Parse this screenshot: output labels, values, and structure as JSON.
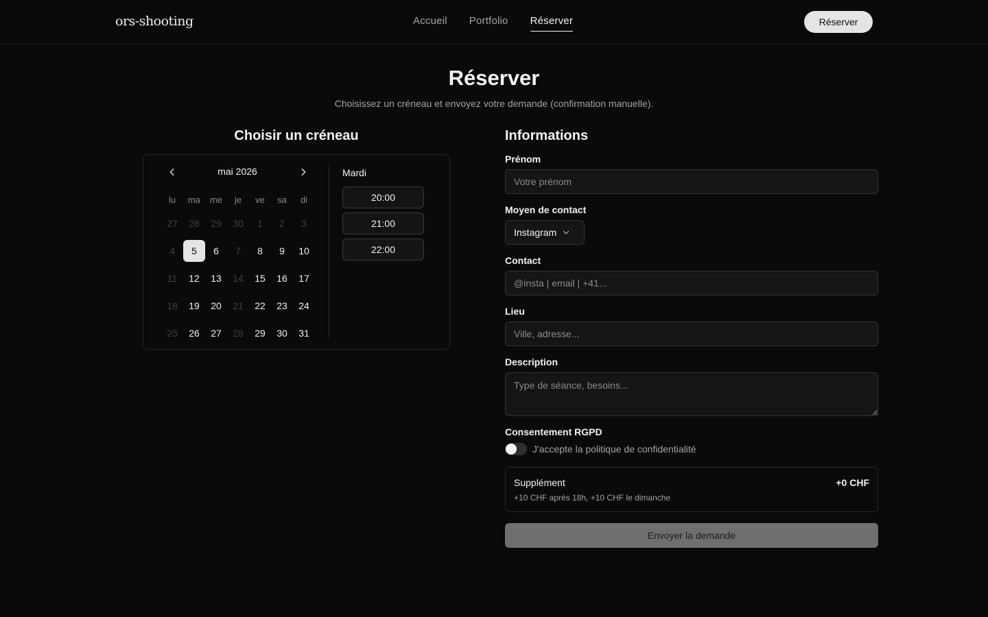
{
  "header": {
    "brand": "ors-shooting",
    "nav": [
      "Accueil",
      "Portfolio",
      "Réserver"
    ],
    "cta": "Réserver"
  },
  "page": {
    "title": "Réserver",
    "subtitle": "Choisissez un créneau et envoyez votre demande (confirmation manuelle)."
  },
  "calendar": {
    "heading": "Choisir un créneau",
    "month": "mai 2026",
    "weekdays": [
      "lu",
      "ma",
      "me",
      "je",
      "ve",
      "sa",
      "di"
    ],
    "days": [
      {
        "d": "27",
        "s": "outside"
      },
      {
        "d": "28",
        "s": "outside"
      },
      {
        "d": "29",
        "s": "outside"
      },
      {
        "d": "30",
        "s": "outside"
      },
      {
        "d": "1",
        "s": "outside"
      },
      {
        "d": "2",
        "s": "outside"
      },
      {
        "d": "3",
        "s": "outside"
      },
      {
        "d": "4",
        "s": "disabled"
      },
      {
        "d": "5",
        "s": "selected"
      },
      {
        "d": "6",
        "s": ""
      },
      {
        "d": "7",
        "s": "disabled"
      },
      {
        "d": "8",
        "s": ""
      },
      {
        "d": "9",
        "s": ""
      },
      {
        "d": "10",
        "s": ""
      },
      {
        "d": "11",
        "s": "disabled"
      },
      {
        "d": "12",
        "s": ""
      },
      {
        "d": "13",
        "s": ""
      },
      {
        "d": "14",
        "s": "disabled"
      },
      {
        "d": "15",
        "s": ""
      },
      {
        "d": "16",
        "s": ""
      },
      {
        "d": "17",
        "s": ""
      },
      {
        "d": "18",
        "s": "disabled"
      },
      {
        "d": "19",
        "s": ""
      },
      {
        "d": "20",
        "s": ""
      },
      {
        "d": "21",
        "s": "disabled"
      },
      {
        "d": "22",
        "s": ""
      },
      {
        "d": "23",
        "s": ""
      },
      {
        "d": "24",
        "s": ""
      },
      {
        "d": "25",
        "s": "disabled"
      },
      {
        "d": "26",
        "s": ""
      },
      {
        "d": "27",
        "s": ""
      },
      {
        "d": "28",
        "s": "disabled"
      },
      {
        "d": "29",
        "s": ""
      },
      {
        "d": "30",
        "s": ""
      },
      {
        "d": "31",
        "s": ""
      }
    ],
    "selected_day_name": "Mardi",
    "time_slots": [
      "20:00",
      "21:00",
      "22:00"
    ]
  },
  "form": {
    "heading": "Informations",
    "first_name": {
      "label": "Prénom",
      "placeholder": "Votre prénom"
    },
    "contact_method": {
      "label": "Moyen de contact",
      "value": "Instagram"
    },
    "contact": {
      "label": "Contact",
      "placeholder": "@insta | email | +41..."
    },
    "location": {
      "label": "Lieu",
      "placeholder": "Ville, adresse..."
    },
    "description": {
      "label": "Description",
      "placeholder": "Type de séance, besoins..."
    },
    "consent": {
      "label": "Consentement RGPD",
      "text": "J'accepte la politique de confidentialité",
      "checked": false
    },
    "supplement": {
      "title": "Supplément",
      "amount": "+0 CHF",
      "note": "+10 CHF après 18h, +10 CHF le dimanche"
    },
    "submit": "Envoyer la demande"
  },
  "colors": {
    "background": "#0a0a0a",
    "accent": "#e5e5e5",
    "muted": "#a3a3a3",
    "border": "#262626"
  }
}
